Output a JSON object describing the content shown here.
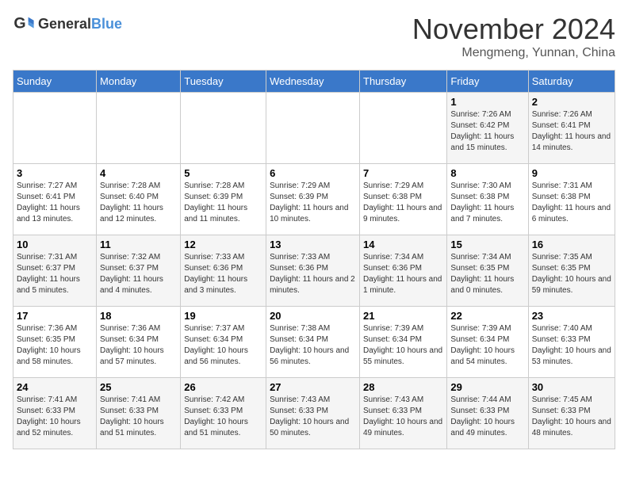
{
  "logo": {
    "text_general": "General",
    "text_blue": "Blue"
  },
  "header": {
    "month": "November 2024",
    "location": "Mengmeng, Yunnan, China"
  },
  "days_of_week": [
    "Sunday",
    "Monday",
    "Tuesday",
    "Wednesday",
    "Thursday",
    "Friday",
    "Saturday"
  ],
  "weeks": [
    [
      {
        "day": "",
        "info": ""
      },
      {
        "day": "",
        "info": ""
      },
      {
        "day": "",
        "info": ""
      },
      {
        "day": "",
        "info": ""
      },
      {
        "day": "",
        "info": ""
      },
      {
        "day": "1",
        "info": "Sunrise: 7:26 AM\nSunset: 6:42 PM\nDaylight: 11 hours and 15 minutes."
      },
      {
        "day": "2",
        "info": "Sunrise: 7:26 AM\nSunset: 6:41 PM\nDaylight: 11 hours and 14 minutes."
      }
    ],
    [
      {
        "day": "3",
        "info": "Sunrise: 7:27 AM\nSunset: 6:41 PM\nDaylight: 11 hours and 13 minutes."
      },
      {
        "day": "4",
        "info": "Sunrise: 7:28 AM\nSunset: 6:40 PM\nDaylight: 11 hours and 12 minutes."
      },
      {
        "day": "5",
        "info": "Sunrise: 7:28 AM\nSunset: 6:39 PM\nDaylight: 11 hours and 11 minutes."
      },
      {
        "day": "6",
        "info": "Sunrise: 7:29 AM\nSunset: 6:39 PM\nDaylight: 11 hours and 10 minutes."
      },
      {
        "day": "7",
        "info": "Sunrise: 7:29 AM\nSunset: 6:38 PM\nDaylight: 11 hours and 9 minutes."
      },
      {
        "day": "8",
        "info": "Sunrise: 7:30 AM\nSunset: 6:38 PM\nDaylight: 11 hours and 7 minutes."
      },
      {
        "day": "9",
        "info": "Sunrise: 7:31 AM\nSunset: 6:38 PM\nDaylight: 11 hours and 6 minutes."
      }
    ],
    [
      {
        "day": "10",
        "info": "Sunrise: 7:31 AM\nSunset: 6:37 PM\nDaylight: 11 hours and 5 minutes."
      },
      {
        "day": "11",
        "info": "Sunrise: 7:32 AM\nSunset: 6:37 PM\nDaylight: 11 hours and 4 minutes."
      },
      {
        "day": "12",
        "info": "Sunrise: 7:33 AM\nSunset: 6:36 PM\nDaylight: 11 hours and 3 minutes."
      },
      {
        "day": "13",
        "info": "Sunrise: 7:33 AM\nSunset: 6:36 PM\nDaylight: 11 hours and 2 minutes."
      },
      {
        "day": "14",
        "info": "Sunrise: 7:34 AM\nSunset: 6:36 PM\nDaylight: 11 hours and 1 minute."
      },
      {
        "day": "15",
        "info": "Sunrise: 7:34 AM\nSunset: 6:35 PM\nDaylight: 11 hours and 0 minutes."
      },
      {
        "day": "16",
        "info": "Sunrise: 7:35 AM\nSunset: 6:35 PM\nDaylight: 10 hours and 59 minutes."
      }
    ],
    [
      {
        "day": "17",
        "info": "Sunrise: 7:36 AM\nSunset: 6:35 PM\nDaylight: 10 hours and 58 minutes."
      },
      {
        "day": "18",
        "info": "Sunrise: 7:36 AM\nSunset: 6:34 PM\nDaylight: 10 hours and 57 minutes."
      },
      {
        "day": "19",
        "info": "Sunrise: 7:37 AM\nSunset: 6:34 PM\nDaylight: 10 hours and 56 minutes."
      },
      {
        "day": "20",
        "info": "Sunrise: 7:38 AM\nSunset: 6:34 PM\nDaylight: 10 hours and 56 minutes."
      },
      {
        "day": "21",
        "info": "Sunrise: 7:39 AM\nSunset: 6:34 PM\nDaylight: 10 hours and 55 minutes."
      },
      {
        "day": "22",
        "info": "Sunrise: 7:39 AM\nSunset: 6:34 PM\nDaylight: 10 hours and 54 minutes."
      },
      {
        "day": "23",
        "info": "Sunrise: 7:40 AM\nSunset: 6:33 PM\nDaylight: 10 hours and 53 minutes."
      }
    ],
    [
      {
        "day": "24",
        "info": "Sunrise: 7:41 AM\nSunset: 6:33 PM\nDaylight: 10 hours and 52 minutes."
      },
      {
        "day": "25",
        "info": "Sunrise: 7:41 AM\nSunset: 6:33 PM\nDaylight: 10 hours and 51 minutes."
      },
      {
        "day": "26",
        "info": "Sunrise: 7:42 AM\nSunset: 6:33 PM\nDaylight: 10 hours and 51 minutes."
      },
      {
        "day": "27",
        "info": "Sunrise: 7:43 AM\nSunset: 6:33 PM\nDaylight: 10 hours and 50 minutes."
      },
      {
        "day": "28",
        "info": "Sunrise: 7:43 AM\nSunset: 6:33 PM\nDaylight: 10 hours and 49 minutes."
      },
      {
        "day": "29",
        "info": "Sunrise: 7:44 AM\nSunset: 6:33 PM\nDaylight: 10 hours and 49 minutes."
      },
      {
        "day": "30",
        "info": "Sunrise: 7:45 AM\nSunset: 6:33 PM\nDaylight: 10 hours and 48 minutes."
      }
    ]
  ]
}
